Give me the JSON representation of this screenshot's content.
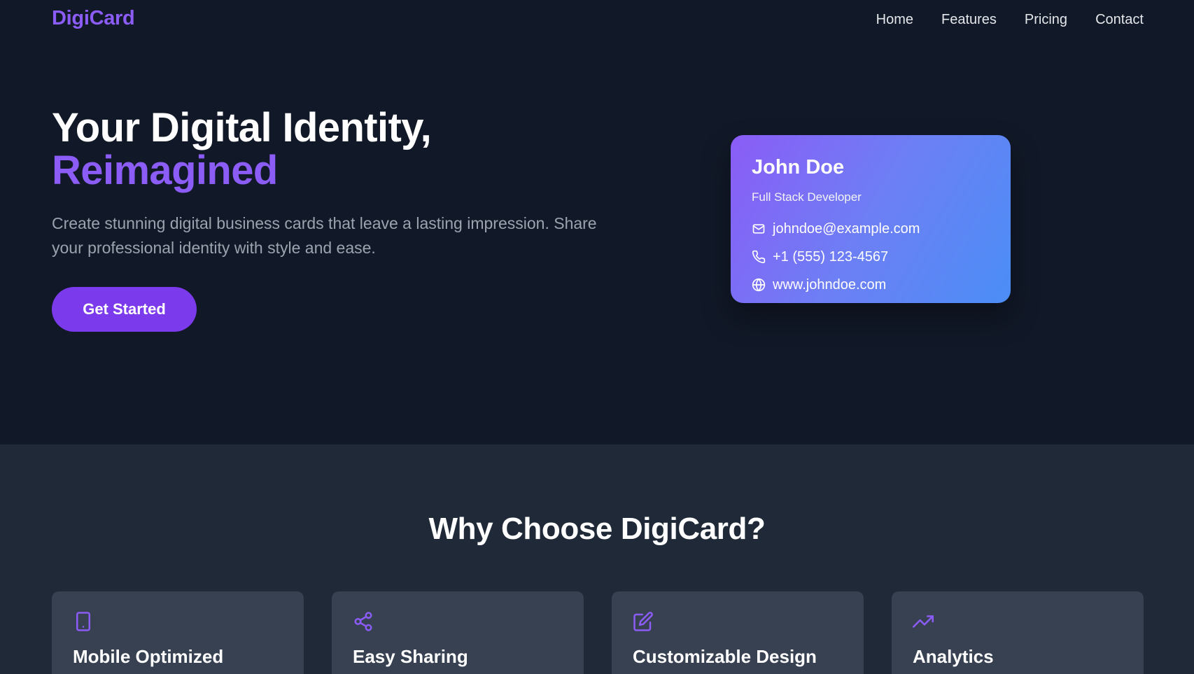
{
  "nav": {
    "logo": "DigiCard",
    "links": [
      "Home",
      "Features",
      "Pricing",
      "Contact"
    ]
  },
  "hero": {
    "title_line1": "Your Digital Identity,",
    "title_line2": "Reimagined",
    "subtitle": "Create stunning digital business cards that leave a lasting impression. Share your professional identity with style and ease.",
    "cta_label": "Get Started"
  },
  "card": {
    "name": "John Doe",
    "role": "Full Stack Developer",
    "email": "johndoe@example.com",
    "phone": "+1 (555) 123-4567",
    "website": "www.johndoe.com"
  },
  "features": {
    "title": "Why Choose DigiCard?",
    "items": [
      {
        "title": "Mobile Optimized",
        "icon": "smartphone-icon"
      },
      {
        "title": "Easy Sharing",
        "icon": "share-icon"
      },
      {
        "title": "Customizable Design",
        "icon": "edit-icon"
      },
      {
        "title": "Analytics",
        "icon": "trending-up-icon"
      }
    ]
  },
  "colors": {
    "background": "#111827",
    "section_bg": "#1f2937",
    "card_bg": "#374151",
    "accent": "#8b5cf6",
    "button": "#7c3aed",
    "gradient_end": "#4b8ef5"
  }
}
